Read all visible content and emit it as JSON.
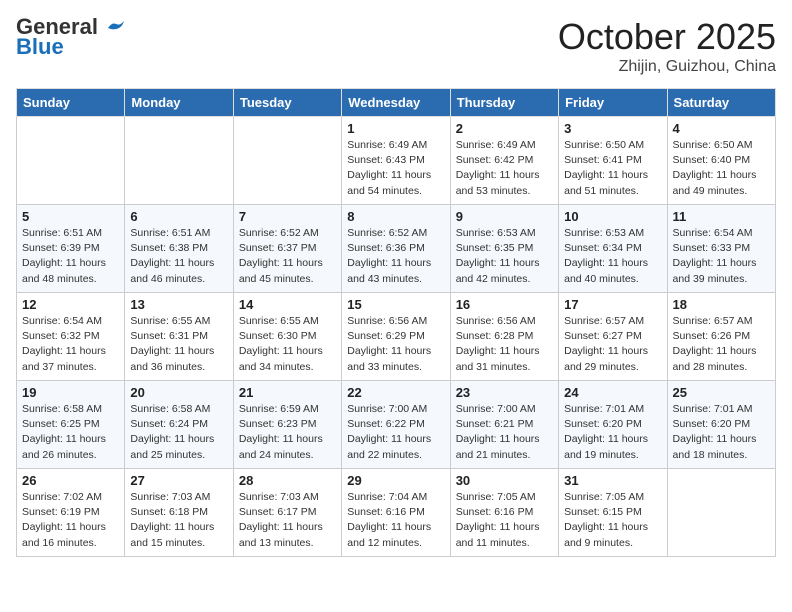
{
  "header": {
    "logo_general": "General",
    "logo_blue": "Blue",
    "month_title": "October 2025",
    "location": "Zhijin, Guizhou, China"
  },
  "weekdays": [
    "Sunday",
    "Monday",
    "Tuesday",
    "Wednesday",
    "Thursday",
    "Friday",
    "Saturday"
  ],
  "weeks": [
    [
      {
        "day": "",
        "info": ""
      },
      {
        "day": "",
        "info": ""
      },
      {
        "day": "",
        "info": ""
      },
      {
        "day": "1",
        "info": "Sunrise: 6:49 AM\nSunset: 6:43 PM\nDaylight: 11 hours\nand 54 minutes."
      },
      {
        "day": "2",
        "info": "Sunrise: 6:49 AM\nSunset: 6:42 PM\nDaylight: 11 hours\nand 53 minutes."
      },
      {
        "day": "3",
        "info": "Sunrise: 6:50 AM\nSunset: 6:41 PM\nDaylight: 11 hours\nand 51 minutes."
      },
      {
        "day": "4",
        "info": "Sunrise: 6:50 AM\nSunset: 6:40 PM\nDaylight: 11 hours\nand 49 minutes."
      }
    ],
    [
      {
        "day": "5",
        "info": "Sunrise: 6:51 AM\nSunset: 6:39 PM\nDaylight: 11 hours\nand 48 minutes."
      },
      {
        "day": "6",
        "info": "Sunrise: 6:51 AM\nSunset: 6:38 PM\nDaylight: 11 hours\nand 46 minutes."
      },
      {
        "day": "7",
        "info": "Sunrise: 6:52 AM\nSunset: 6:37 PM\nDaylight: 11 hours\nand 45 minutes."
      },
      {
        "day": "8",
        "info": "Sunrise: 6:52 AM\nSunset: 6:36 PM\nDaylight: 11 hours\nand 43 minutes."
      },
      {
        "day": "9",
        "info": "Sunrise: 6:53 AM\nSunset: 6:35 PM\nDaylight: 11 hours\nand 42 minutes."
      },
      {
        "day": "10",
        "info": "Sunrise: 6:53 AM\nSunset: 6:34 PM\nDaylight: 11 hours\nand 40 minutes."
      },
      {
        "day": "11",
        "info": "Sunrise: 6:54 AM\nSunset: 6:33 PM\nDaylight: 11 hours\nand 39 minutes."
      }
    ],
    [
      {
        "day": "12",
        "info": "Sunrise: 6:54 AM\nSunset: 6:32 PM\nDaylight: 11 hours\nand 37 minutes."
      },
      {
        "day": "13",
        "info": "Sunrise: 6:55 AM\nSunset: 6:31 PM\nDaylight: 11 hours\nand 36 minutes."
      },
      {
        "day": "14",
        "info": "Sunrise: 6:55 AM\nSunset: 6:30 PM\nDaylight: 11 hours\nand 34 minutes."
      },
      {
        "day": "15",
        "info": "Sunrise: 6:56 AM\nSunset: 6:29 PM\nDaylight: 11 hours\nand 33 minutes."
      },
      {
        "day": "16",
        "info": "Sunrise: 6:56 AM\nSunset: 6:28 PM\nDaylight: 11 hours\nand 31 minutes."
      },
      {
        "day": "17",
        "info": "Sunrise: 6:57 AM\nSunset: 6:27 PM\nDaylight: 11 hours\nand 29 minutes."
      },
      {
        "day": "18",
        "info": "Sunrise: 6:57 AM\nSunset: 6:26 PM\nDaylight: 11 hours\nand 28 minutes."
      }
    ],
    [
      {
        "day": "19",
        "info": "Sunrise: 6:58 AM\nSunset: 6:25 PM\nDaylight: 11 hours\nand 26 minutes."
      },
      {
        "day": "20",
        "info": "Sunrise: 6:58 AM\nSunset: 6:24 PM\nDaylight: 11 hours\nand 25 minutes."
      },
      {
        "day": "21",
        "info": "Sunrise: 6:59 AM\nSunset: 6:23 PM\nDaylight: 11 hours\nand 24 minutes."
      },
      {
        "day": "22",
        "info": "Sunrise: 7:00 AM\nSunset: 6:22 PM\nDaylight: 11 hours\nand 22 minutes."
      },
      {
        "day": "23",
        "info": "Sunrise: 7:00 AM\nSunset: 6:21 PM\nDaylight: 11 hours\nand 21 minutes."
      },
      {
        "day": "24",
        "info": "Sunrise: 7:01 AM\nSunset: 6:20 PM\nDaylight: 11 hours\nand 19 minutes."
      },
      {
        "day": "25",
        "info": "Sunrise: 7:01 AM\nSunset: 6:20 PM\nDaylight: 11 hours\nand 18 minutes."
      }
    ],
    [
      {
        "day": "26",
        "info": "Sunrise: 7:02 AM\nSunset: 6:19 PM\nDaylight: 11 hours\nand 16 minutes."
      },
      {
        "day": "27",
        "info": "Sunrise: 7:03 AM\nSunset: 6:18 PM\nDaylight: 11 hours\nand 15 minutes."
      },
      {
        "day": "28",
        "info": "Sunrise: 7:03 AM\nSunset: 6:17 PM\nDaylight: 11 hours\nand 13 minutes."
      },
      {
        "day": "29",
        "info": "Sunrise: 7:04 AM\nSunset: 6:16 PM\nDaylight: 11 hours\nand 12 minutes."
      },
      {
        "day": "30",
        "info": "Sunrise: 7:05 AM\nSunset: 6:16 PM\nDaylight: 11 hours\nand 11 minutes."
      },
      {
        "day": "31",
        "info": "Sunrise: 7:05 AM\nSunset: 6:15 PM\nDaylight: 11 hours\nand 9 minutes."
      },
      {
        "day": "",
        "info": ""
      }
    ]
  ]
}
